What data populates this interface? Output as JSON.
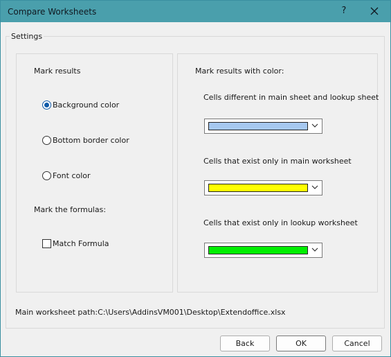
{
  "window": {
    "title": "Compare Worksheets",
    "help_label": "?"
  },
  "settings": {
    "group_label": "Settings",
    "mark_results": {
      "heading": "Mark results",
      "options": [
        "Background color",
        "Bottom border color",
        "Font color"
      ],
      "selected": "Background color"
    },
    "mark_formulas": {
      "heading": "Mark the formulas:",
      "checkbox_label": "Match Formula",
      "checked": false
    },
    "colors": {
      "heading": "Mark results with color:",
      "items": [
        {
          "label": "Cells different in main sheet and lookup sheet",
          "color": "#a6c8f0"
        },
        {
          "label": "Cells that exist only in main worksheet",
          "color": "#ffff00"
        },
        {
          "label": "Cells that exist only in lookup worksheet",
          "color": "#00ee00"
        }
      ]
    },
    "path_text": "Main worksheet path:C:\\Users\\AddinsVM001\\Desktop\\Extendoffice.xlsx"
  },
  "buttons": {
    "back": "Back",
    "ok": "OK",
    "cancel": "Cancel"
  }
}
